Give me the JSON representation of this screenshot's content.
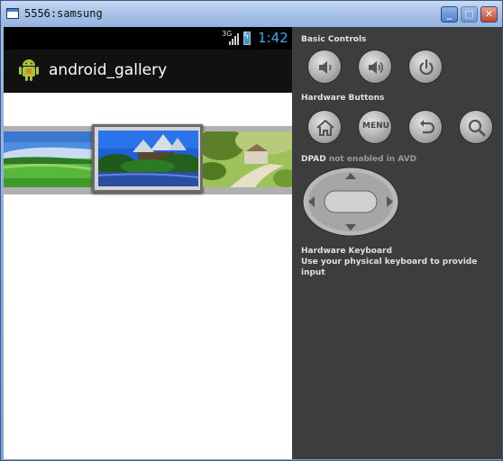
{
  "window": {
    "title": "5556:samsung"
  },
  "status_bar": {
    "network": "3G",
    "time": "1:42"
  },
  "action_bar": {
    "title": "android_gallery"
  },
  "controls": {
    "basic_title": "Basic Controls",
    "hardware_title": "Hardware Buttons",
    "menu_label": "MENU",
    "dpad_title": "DPAD",
    "dpad_note": "not enabled in AVD",
    "keyboard_title": "Hardware Keyboard",
    "keyboard_note": "Use your physical keyboard to provide input"
  }
}
